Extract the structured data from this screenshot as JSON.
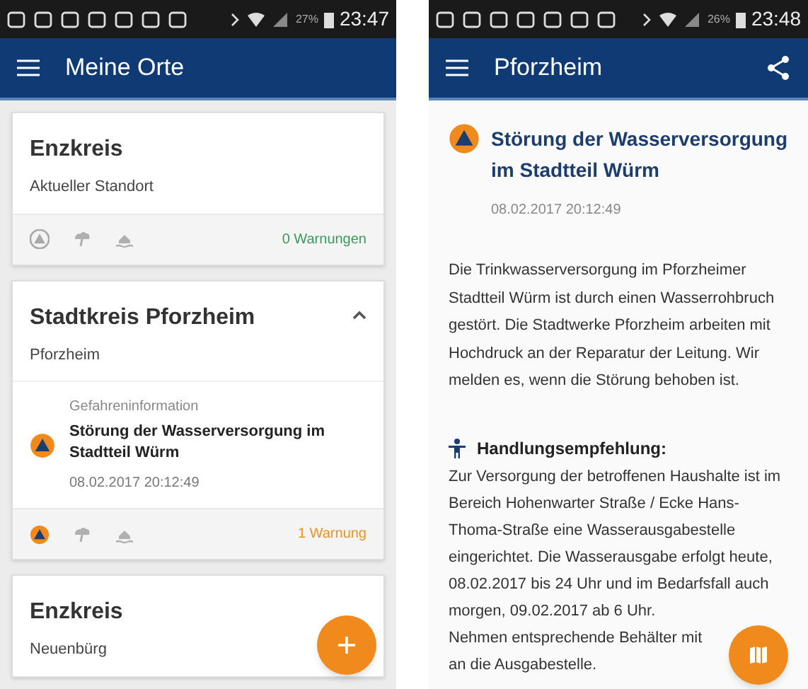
{
  "screens": [
    {
      "status_bar": {
        "battery": "27%",
        "time": "23:47"
      },
      "app_bar": {
        "title": "Meine Orte"
      },
      "fab": {
        "kind": "plus"
      },
      "cards": [
        {
          "title": "Enzkreis",
          "subtitle": "Aktueller Standort",
          "expanded": false,
          "footer": {
            "icons": [
              {
                "kind": "warning",
                "active": false
              },
              {
                "kind": "weather",
                "active": false
              },
              {
                "kind": "flood",
                "active": false
              }
            ],
            "count": "0 Warnungen",
            "color": "#3a9a5c"
          }
        },
        {
          "title": "Stadtkreis Pforzheim",
          "subtitle": "Pforzheim",
          "expanded": true,
          "warnings": [
            {
              "category": "Gefahreninformation",
              "title": "Störung der Wasserversorgung im Stadtteil Würm",
              "date": "08.02.2017 20:12:49"
            }
          ],
          "footer": {
            "icons": [
              {
                "kind": "warning",
                "active": true
              },
              {
                "kind": "weather",
                "active": false
              },
              {
                "kind": "flood",
                "active": false
              }
            ],
            "count": "1 Warnung",
            "color": "#f0901e"
          }
        },
        {
          "title": "Enzkreis",
          "subtitle": "Neuenbürg",
          "expanded": false
        }
      ]
    },
    {
      "status_bar": {
        "battery": "26%",
        "time": "23:48"
      },
      "app_bar": {
        "title": "Pforzheim",
        "share": true
      },
      "fab": {
        "kind": "map"
      },
      "detail": {
        "title": "Störung der Wasserversorgung im Stadtteil Würm",
        "date": "08.02.2017 20:12:49",
        "description": "Die Trinkwasserversorgung im Pforzheimer Stadtteil Würm ist durch einen Wasserrohbruch gestört. Die Stadtwerke Pforzheim arbeiten mit Hochdruck an der Reparatur der Leitung. Wir melden es, wenn die Störung behoben ist.",
        "recommendation_heading": "Handlungsempfehlung:",
        "recommendation": [
          "Zur Versorgung der betroffenen Haushalte ist im Bereich Hohenwarter Straße / Ecke Hans-Thoma-Straße eine Wasserausgabestelle eingerichtet. Die Wasserausgabe erfolgt heute, 08.02.2017 bis 24 Uhr und im Bedarfsfall auch morgen, 09.02.2017 ab 6 Uhr.",
          "Nehmen entsprechende Behälter mit an die Ausgabestelle."
        ]
      }
    }
  ]
}
